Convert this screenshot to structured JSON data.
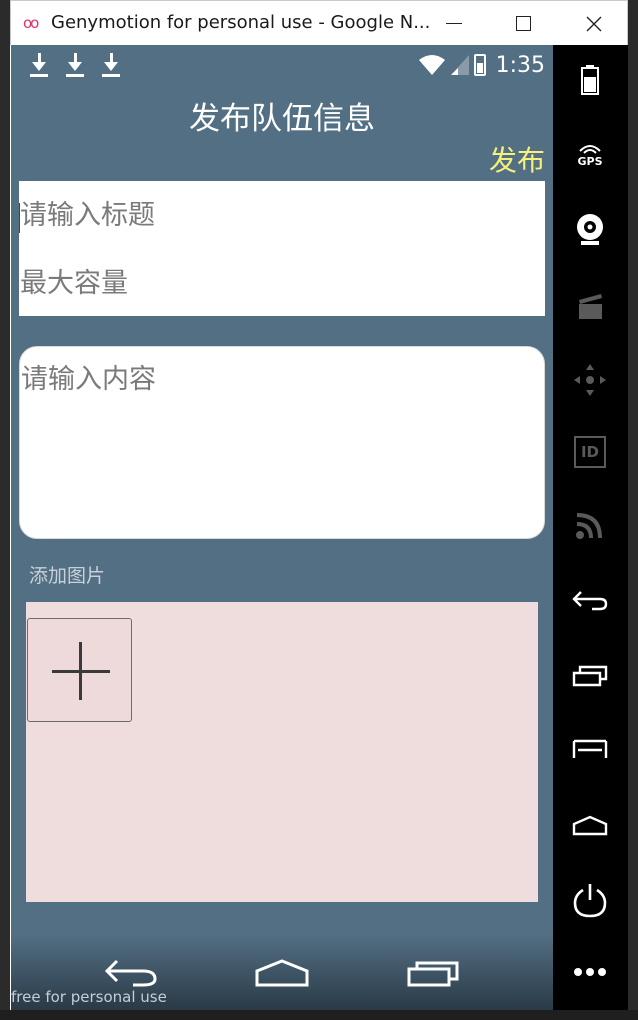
{
  "window": {
    "title": "Genymotion for personal use - Google N..."
  },
  "statusbar": {
    "time": "1:35",
    "icons": [
      "download-icon",
      "download-icon",
      "download-icon",
      "wifi-icon",
      "signal-icon",
      "battery-charging-icon"
    ]
  },
  "app": {
    "title": "发布队伍信息",
    "publish_label": "发布",
    "title_placeholder": "请输入标题",
    "capacity_placeholder": "最大容量",
    "content_placeholder": "请输入内容",
    "add_image_label": "添加图片"
  },
  "navbar": {
    "buttons": [
      "back-icon",
      "home-icon",
      "recents-icon"
    ]
  },
  "watermark": "free for personal use",
  "sidebar": {
    "items": [
      "battery-icon",
      "gps-icon",
      "webcam-icon",
      "video-icon",
      "dpad-icon",
      "id-icon",
      "rss-icon",
      "back-icon",
      "recents-icon",
      "menu-icon",
      "home-icon",
      "power-icon",
      "more-icon"
    ],
    "gps_label": "GPS",
    "id_label": "ID"
  },
  "colors": {
    "app_background": "#536f83",
    "publish_accent": "#f7f07a",
    "image_area": "#efdcdc"
  }
}
